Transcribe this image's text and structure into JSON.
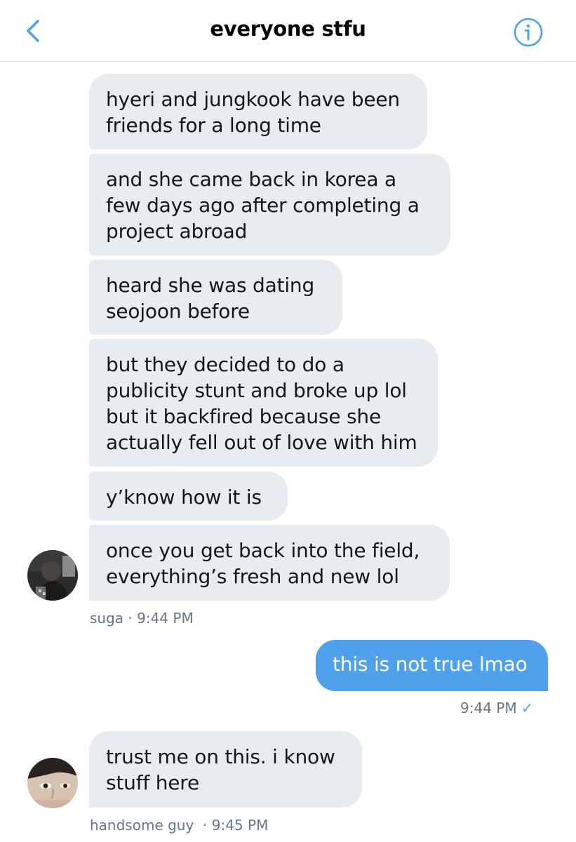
{
  "header": {
    "title": "everyone stfu"
  },
  "messages_group1": [
    "hyeri and jungkook have been friends for a long time",
    "and she came back in korea a few days ago after completing a project abroad",
    "heard she was dating seojoon before",
    "but they decided to do a publicity stunt and broke up lol but it backfired because she actually fell out of love with him",
    "y’know how it is",
    "once you get back into the field, everything’s fresh and new lol"
  ],
  "group1_meta": "suga · 9:44 PM",
  "sent_message": {
    "text": "this is not true lmao",
    "time": "9:44 PM",
    "status_icon": "check-icon"
  },
  "messages_group2": [
    "trust me on this. i know stuff here"
  ],
  "group2_meta": "handsome guy  · 9:45 PM",
  "colors": {
    "accent": "#4ea1ea",
    "received_bubble": "#e6ecf0",
    "meta_text": "#657786"
  }
}
